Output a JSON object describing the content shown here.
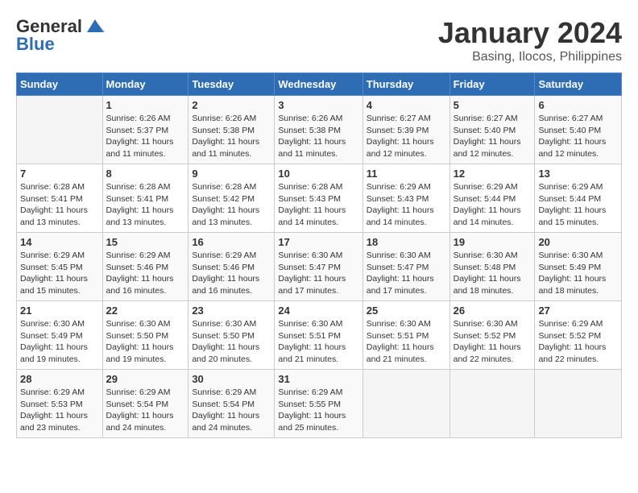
{
  "logo": {
    "general": "General",
    "blue": "Blue"
  },
  "title": "January 2024",
  "location": "Basing, Ilocos, Philippines",
  "headers": [
    "Sunday",
    "Monday",
    "Tuesday",
    "Wednesday",
    "Thursday",
    "Friday",
    "Saturday"
  ],
  "weeks": [
    [
      {
        "day": "",
        "info": ""
      },
      {
        "day": "1",
        "info": "Sunrise: 6:26 AM\nSunset: 5:37 PM\nDaylight: 11 hours and 11 minutes."
      },
      {
        "day": "2",
        "info": "Sunrise: 6:26 AM\nSunset: 5:38 PM\nDaylight: 11 hours and 11 minutes."
      },
      {
        "day": "3",
        "info": "Sunrise: 6:26 AM\nSunset: 5:38 PM\nDaylight: 11 hours and 11 minutes."
      },
      {
        "day": "4",
        "info": "Sunrise: 6:27 AM\nSunset: 5:39 PM\nDaylight: 11 hours and 12 minutes."
      },
      {
        "day": "5",
        "info": "Sunrise: 6:27 AM\nSunset: 5:40 PM\nDaylight: 11 hours and 12 minutes."
      },
      {
        "day": "6",
        "info": "Sunrise: 6:27 AM\nSunset: 5:40 PM\nDaylight: 11 hours and 12 minutes."
      }
    ],
    [
      {
        "day": "7",
        "info": "Sunrise: 6:28 AM\nSunset: 5:41 PM\nDaylight: 11 hours and 13 minutes."
      },
      {
        "day": "8",
        "info": "Sunrise: 6:28 AM\nSunset: 5:41 PM\nDaylight: 11 hours and 13 minutes."
      },
      {
        "day": "9",
        "info": "Sunrise: 6:28 AM\nSunset: 5:42 PM\nDaylight: 11 hours and 13 minutes."
      },
      {
        "day": "10",
        "info": "Sunrise: 6:28 AM\nSunset: 5:43 PM\nDaylight: 11 hours and 14 minutes."
      },
      {
        "day": "11",
        "info": "Sunrise: 6:29 AM\nSunset: 5:43 PM\nDaylight: 11 hours and 14 minutes."
      },
      {
        "day": "12",
        "info": "Sunrise: 6:29 AM\nSunset: 5:44 PM\nDaylight: 11 hours and 14 minutes."
      },
      {
        "day": "13",
        "info": "Sunrise: 6:29 AM\nSunset: 5:44 PM\nDaylight: 11 hours and 15 minutes."
      }
    ],
    [
      {
        "day": "14",
        "info": "Sunrise: 6:29 AM\nSunset: 5:45 PM\nDaylight: 11 hours and 15 minutes."
      },
      {
        "day": "15",
        "info": "Sunrise: 6:29 AM\nSunset: 5:46 PM\nDaylight: 11 hours and 16 minutes."
      },
      {
        "day": "16",
        "info": "Sunrise: 6:29 AM\nSunset: 5:46 PM\nDaylight: 11 hours and 16 minutes."
      },
      {
        "day": "17",
        "info": "Sunrise: 6:30 AM\nSunset: 5:47 PM\nDaylight: 11 hours and 17 minutes."
      },
      {
        "day": "18",
        "info": "Sunrise: 6:30 AM\nSunset: 5:47 PM\nDaylight: 11 hours and 17 minutes."
      },
      {
        "day": "19",
        "info": "Sunrise: 6:30 AM\nSunset: 5:48 PM\nDaylight: 11 hours and 18 minutes."
      },
      {
        "day": "20",
        "info": "Sunrise: 6:30 AM\nSunset: 5:49 PM\nDaylight: 11 hours and 18 minutes."
      }
    ],
    [
      {
        "day": "21",
        "info": "Sunrise: 6:30 AM\nSunset: 5:49 PM\nDaylight: 11 hours and 19 minutes."
      },
      {
        "day": "22",
        "info": "Sunrise: 6:30 AM\nSunset: 5:50 PM\nDaylight: 11 hours and 19 minutes."
      },
      {
        "day": "23",
        "info": "Sunrise: 6:30 AM\nSunset: 5:50 PM\nDaylight: 11 hours and 20 minutes."
      },
      {
        "day": "24",
        "info": "Sunrise: 6:30 AM\nSunset: 5:51 PM\nDaylight: 11 hours and 21 minutes."
      },
      {
        "day": "25",
        "info": "Sunrise: 6:30 AM\nSunset: 5:51 PM\nDaylight: 11 hours and 21 minutes."
      },
      {
        "day": "26",
        "info": "Sunrise: 6:30 AM\nSunset: 5:52 PM\nDaylight: 11 hours and 22 minutes."
      },
      {
        "day": "27",
        "info": "Sunrise: 6:29 AM\nSunset: 5:52 PM\nDaylight: 11 hours and 22 minutes."
      }
    ],
    [
      {
        "day": "28",
        "info": "Sunrise: 6:29 AM\nSunset: 5:53 PM\nDaylight: 11 hours and 23 minutes."
      },
      {
        "day": "29",
        "info": "Sunrise: 6:29 AM\nSunset: 5:54 PM\nDaylight: 11 hours and 24 minutes."
      },
      {
        "day": "30",
        "info": "Sunrise: 6:29 AM\nSunset: 5:54 PM\nDaylight: 11 hours and 24 minutes."
      },
      {
        "day": "31",
        "info": "Sunrise: 6:29 AM\nSunset: 5:55 PM\nDaylight: 11 hours and 25 minutes."
      },
      {
        "day": "",
        "info": ""
      },
      {
        "day": "",
        "info": ""
      },
      {
        "day": "",
        "info": ""
      }
    ]
  ]
}
